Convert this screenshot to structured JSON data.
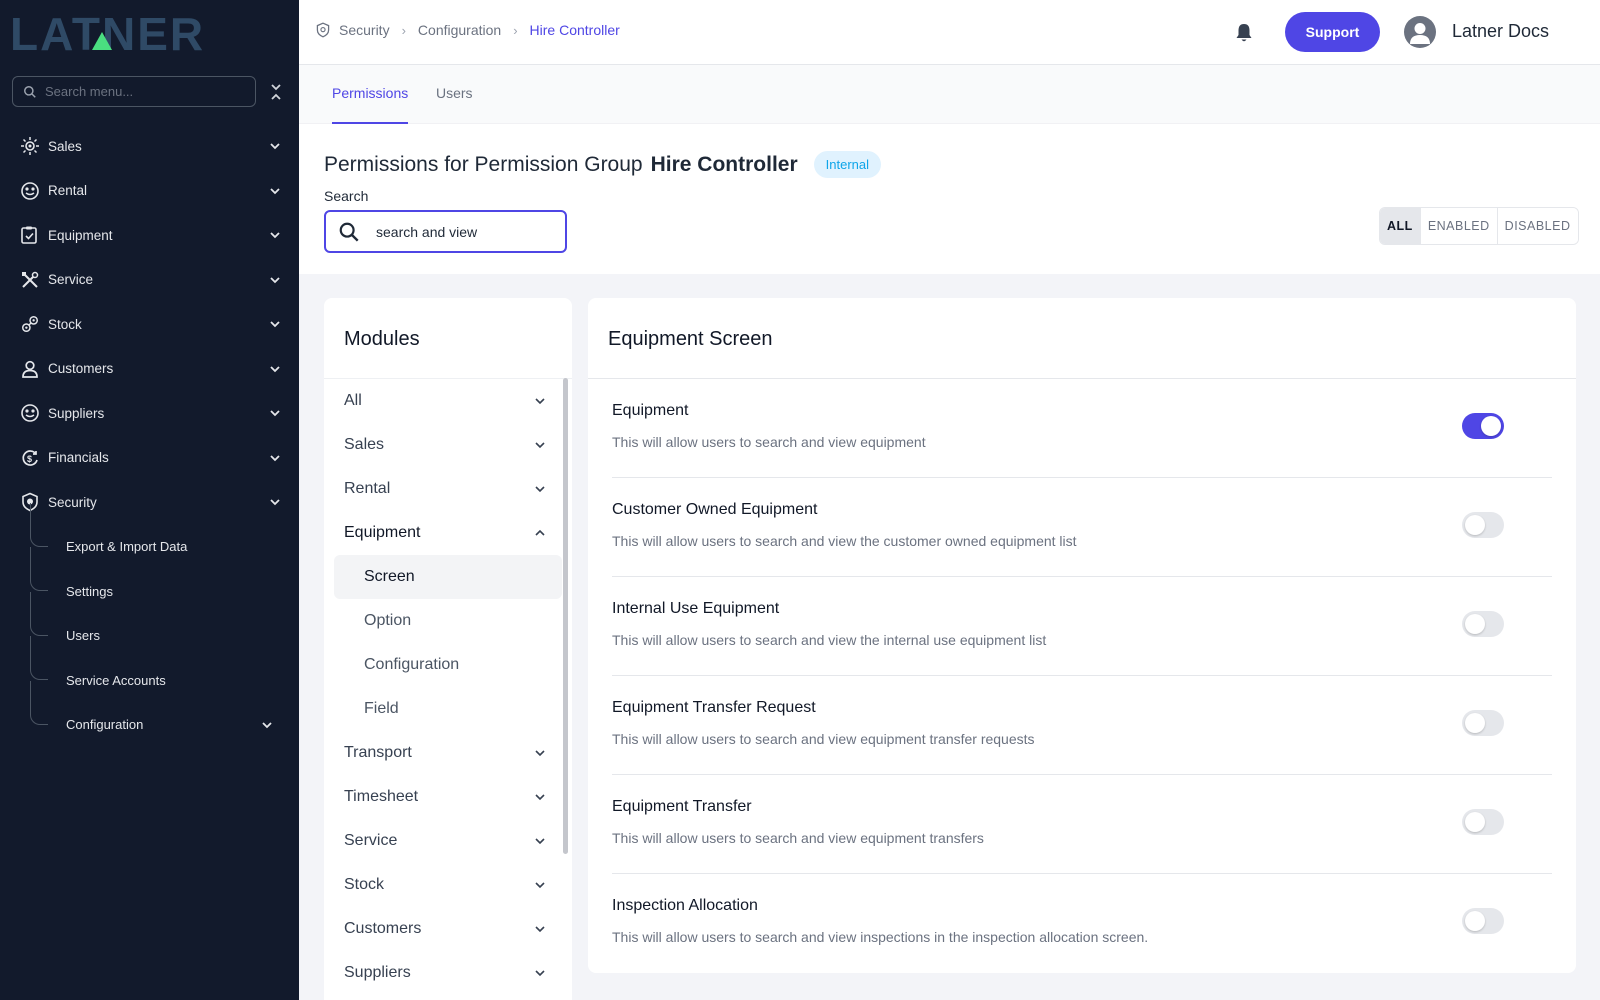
{
  "brand": {
    "logo_text": "LATNER",
    "logo_color": "#2f4a66",
    "logo_accent": "#4ade80"
  },
  "sidebar": {
    "search_placeholder": "Search menu...",
    "items": [
      {
        "label": "Sales",
        "icon": "sales-icon"
      },
      {
        "label": "Rental",
        "icon": "rental-icon"
      },
      {
        "label": "Equipment",
        "icon": "equipment-icon"
      },
      {
        "label": "Service",
        "icon": "tools-icon"
      },
      {
        "label": "Stock",
        "icon": "stock-icon"
      },
      {
        "label": "Customers",
        "icon": "user-icon"
      },
      {
        "label": "Suppliers",
        "icon": "suppliers-icon"
      },
      {
        "label": "Financials",
        "icon": "financials-icon"
      },
      {
        "label": "Security",
        "icon": "shield-icon"
      }
    ],
    "security_sub": [
      {
        "label": "Export & Import Data"
      },
      {
        "label": "Settings"
      },
      {
        "label": "Users"
      },
      {
        "label": "Service Accounts"
      },
      {
        "label": "Configuration"
      }
    ]
  },
  "topbar": {
    "breadcrumb": [
      "Security",
      "Configuration",
      "Hire Controller"
    ],
    "support_label": "Support",
    "user_name": "Latner Docs"
  },
  "tabs": [
    {
      "label": "Permissions",
      "active": true
    },
    {
      "label": "Users",
      "active": false
    }
  ],
  "header": {
    "title_prefix": "Permissions for Permission Group",
    "group_name": "Hire Controller",
    "badge": "Internal",
    "search_label": "Search",
    "search_value": "search and view",
    "filters": [
      "ALL",
      "ENABLED",
      "DISABLED"
    ],
    "active_filter": "ALL"
  },
  "modules": {
    "title": "Modules",
    "items": [
      "All",
      "Sales",
      "Rental",
      "Equipment"
    ],
    "equipment_sub": [
      "Screen",
      "Option",
      "Configuration",
      "Field"
    ],
    "items_after": [
      "Transport",
      "Timesheet",
      "Service",
      "Stock",
      "Customers",
      "Suppliers"
    ],
    "selected": "Screen"
  },
  "equipment_screen": {
    "title": "Equipment Screen",
    "permissions": [
      {
        "name": "Equipment",
        "description": "This will allow users to search and view equipment",
        "enabled": true
      },
      {
        "name": "Customer Owned Equipment",
        "description": "This will allow users to search and view the customer owned equipment list",
        "enabled": false
      },
      {
        "name": "Internal Use Equipment",
        "description": "This will allow users to search and view the internal use equipment list",
        "enabled": false
      },
      {
        "name": "Equipment Transfer Request",
        "description": "This will allow users to search and view equipment transfer requests",
        "enabled": false
      },
      {
        "name": "Equipment Transfer",
        "description": "This will allow users to search and view equipment transfers",
        "enabled": false
      },
      {
        "name": "Inspection Allocation",
        "description": "This will allow users to search and view inspections in the inspection allocation screen.",
        "enabled": false
      }
    ]
  },
  "colors": {
    "accent": "#4f46e5",
    "sidebar_bg": "#121a2c",
    "badge_bg": "#e0f2fe",
    "badge_text": "#0ea5e9"
  }
}
